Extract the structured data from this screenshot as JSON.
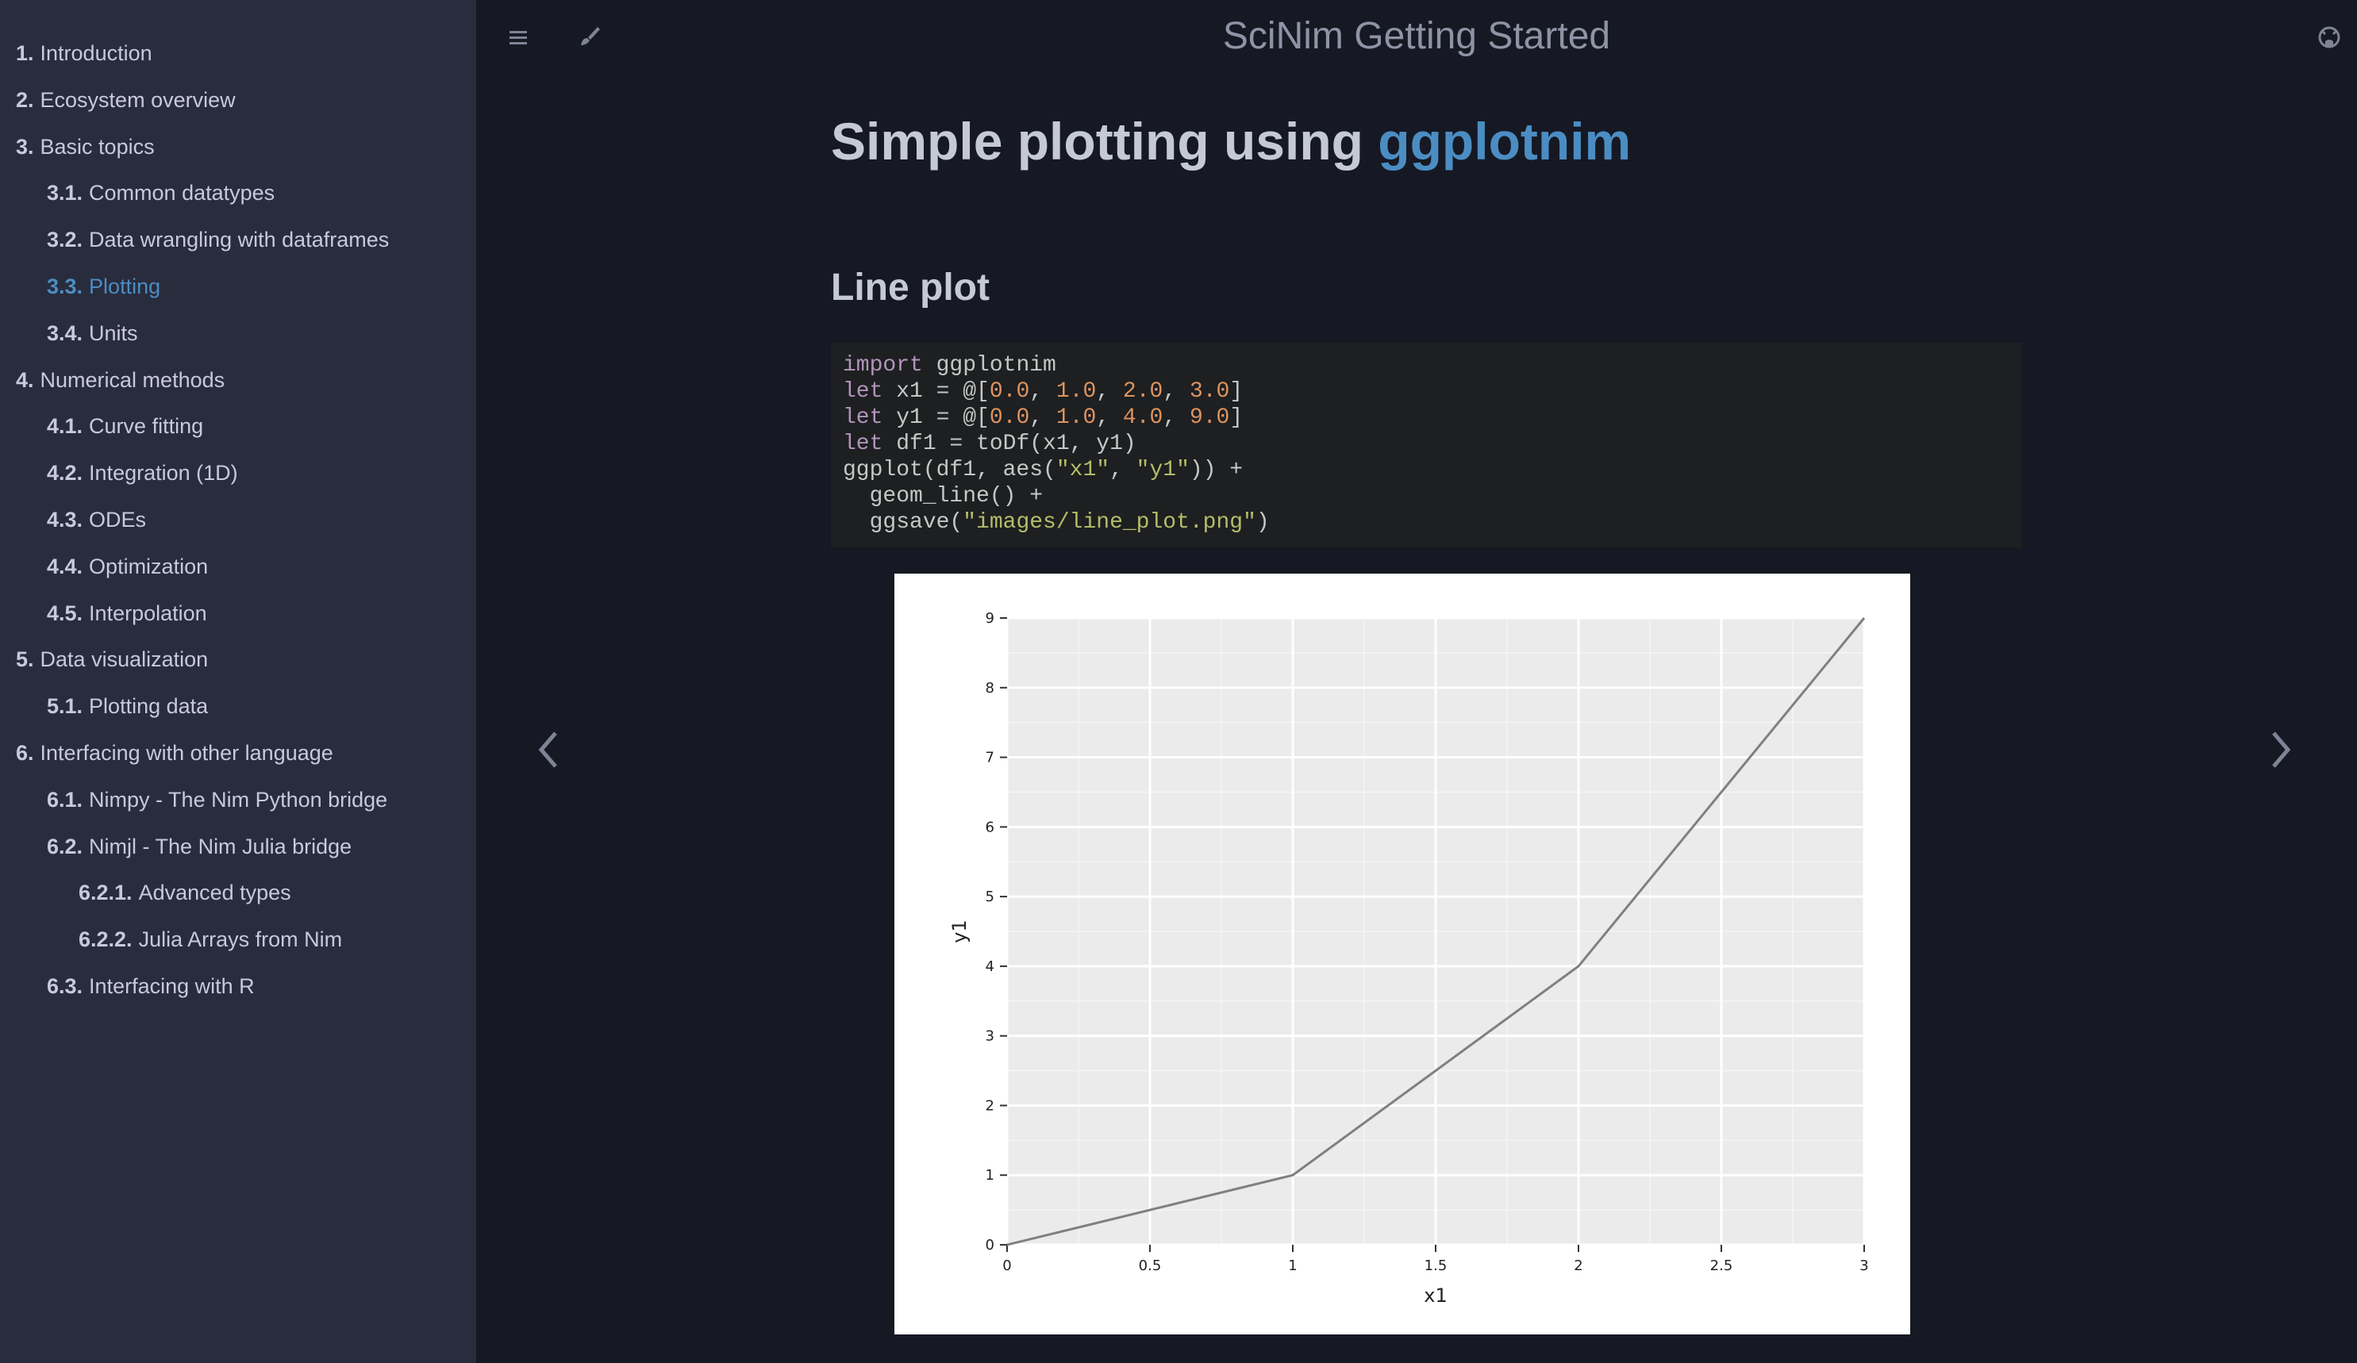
{
  "colors": {
    "sidebar_bg": "#292c3d",
    "page_bg": "#161923",
    "accent": "#4b8dc3",
    "text": "#c8c9db",
    "code_bg": "#1d1f21",
    "plot_bg": "#ebebeb",
    "plot_line": "#808080"
  },
  "sidebar": {
    "items": [
      {
        "num": "1.",
        "label": "Introduction"
      },
      {
        "num": "2.",
        "label": "Ecosystem overview"
      },
      {
        "num": "3.",
        "label": "Basic topics"
      },
      {
        "num": "3.1.",
        "label": "Common datatypes"
      },
      {
        "num": "3.2.",
        "label": "Data wrangling with dataframes"
      },
      {
        "num": "3.3.",
        "label": "Plotting",
        "active": true
      },
      {
        "num": "3.4.",
        "label": "Units"
      },
      {
        "num": "4.",
        "label": "Numerical methods"
      },
      {
        "num": "4.1.",
        "label": "Curve fitting"
      },
      {
        "num": "4.2.",
        "label": "Integration (1D)"
      },
      {
        "num": "4.3.",
        "label": "ODEs"
      },
      {
        "num": "4.4.",
        "label": "Optimization"
      },
      {
        "num": "4.5.",
        "label": "Interpolation"
      },
      {
        "num": "5.",
        "label": "Data visualization"
      },
      {
        "num": "5.1.",
        "label": "Plotting data"
      },
      {
        "num": "6.",
        "label": "Interfacing with other language"
      },
      {
        "num": "6.1.",
        "label": "Nimpy - The Nim Python bridge"
      },
      {
        "num": "6.2.",
        "label": "Nimjl - The Nim Julia bridge"
      },
      {
        "num": "6.2.1.",
        "label": "Advanced types"
      },
      {
        "num": "6.2.2.",
        "label": "Julia Arrays from Nim"
      },
      {
        "num": "6.3.",
        "label": "Interfacing with R"
      }
    ]
  },
  "menubar": {
    "title": "SciNim Getting Started",
    "icons": [
      "hamburger-menu-icon",
      "paintbrush-icon",
      "github-icon"
    ]
  },
  "content": {
    "title_prefix": "Simple plotting using ",
    "title_link": "ggplotnim",
    "section_title": "Line plot",
    "code": {
      "line1_kw": "import",
      "line1_rest": " ggplotnim",
      "line2_kw": "let",
      "line2_a": " x1 = @[",
      "line2_v1": "0.0",
      "line2_v2": "1.0",
      "line2_v3": "2.0",
      "line2_v4": "3.0",
      "line3_kw": "let",
      "line3_a": " y1 = @[",
      "line3_v1": "0.0",
      "line3_v2": "1.0",
      "line3_v3": "4.0",
      "line3_v4": "9.0",
      "line4_kw": "let",
      "line4_rest": " df1 = toDf(x1, y1)",
      "line5_a": "ggplot(df1, aes(",
      "line5_s1": "\"x1\"",
      "line5_sep": ", ",
      "line5_s2": "\"y1\"",
      "line5_b": ")) +",
      "line6": "  geom_line() +",
      "line7_a": "  ggsave(",
      "line7_s": "\"images/line_plot.png\"",
      "line7_b": ")"
    }
  },
  "nav": {
    "prev_icon": "chevron-left-icon",
    "next_icon": "chevron-right-icon"
  },
  "chart_data": {
    "type": "line",
    "x": [
      0,
      1,
      2,
      3
    ],
    "y": [
      0,
      1,
      4,
      9
    ],
    "xlabel": "x1",
    "ylabel": "y1",
    "xlim": [
      0,
      3
    ],
    "ylim": [
      0,
      9
    ],
    "xticks": [
      0,
      0.5,
      1,
      1.5,
      2,
      2.5,
      3
    ],
    "xtick_labels": [
      "0",
      "0.5",
      "1",
      "1.5",
      "2",
      "2.5",
      "3"
    ],
    "yticks": [
      0,
      1,
      2,
      3,
      4,
      5,
      6,
      7,
      8,
      9
    ],
    "ytick_labels": [
      "0",
      "1",
      "2",
      "3",
      "4",
      "5",
      "6",
      "7",
      "8",
      "9"
    ],
    "grid": true,
    "legend": "none"
  }
}
